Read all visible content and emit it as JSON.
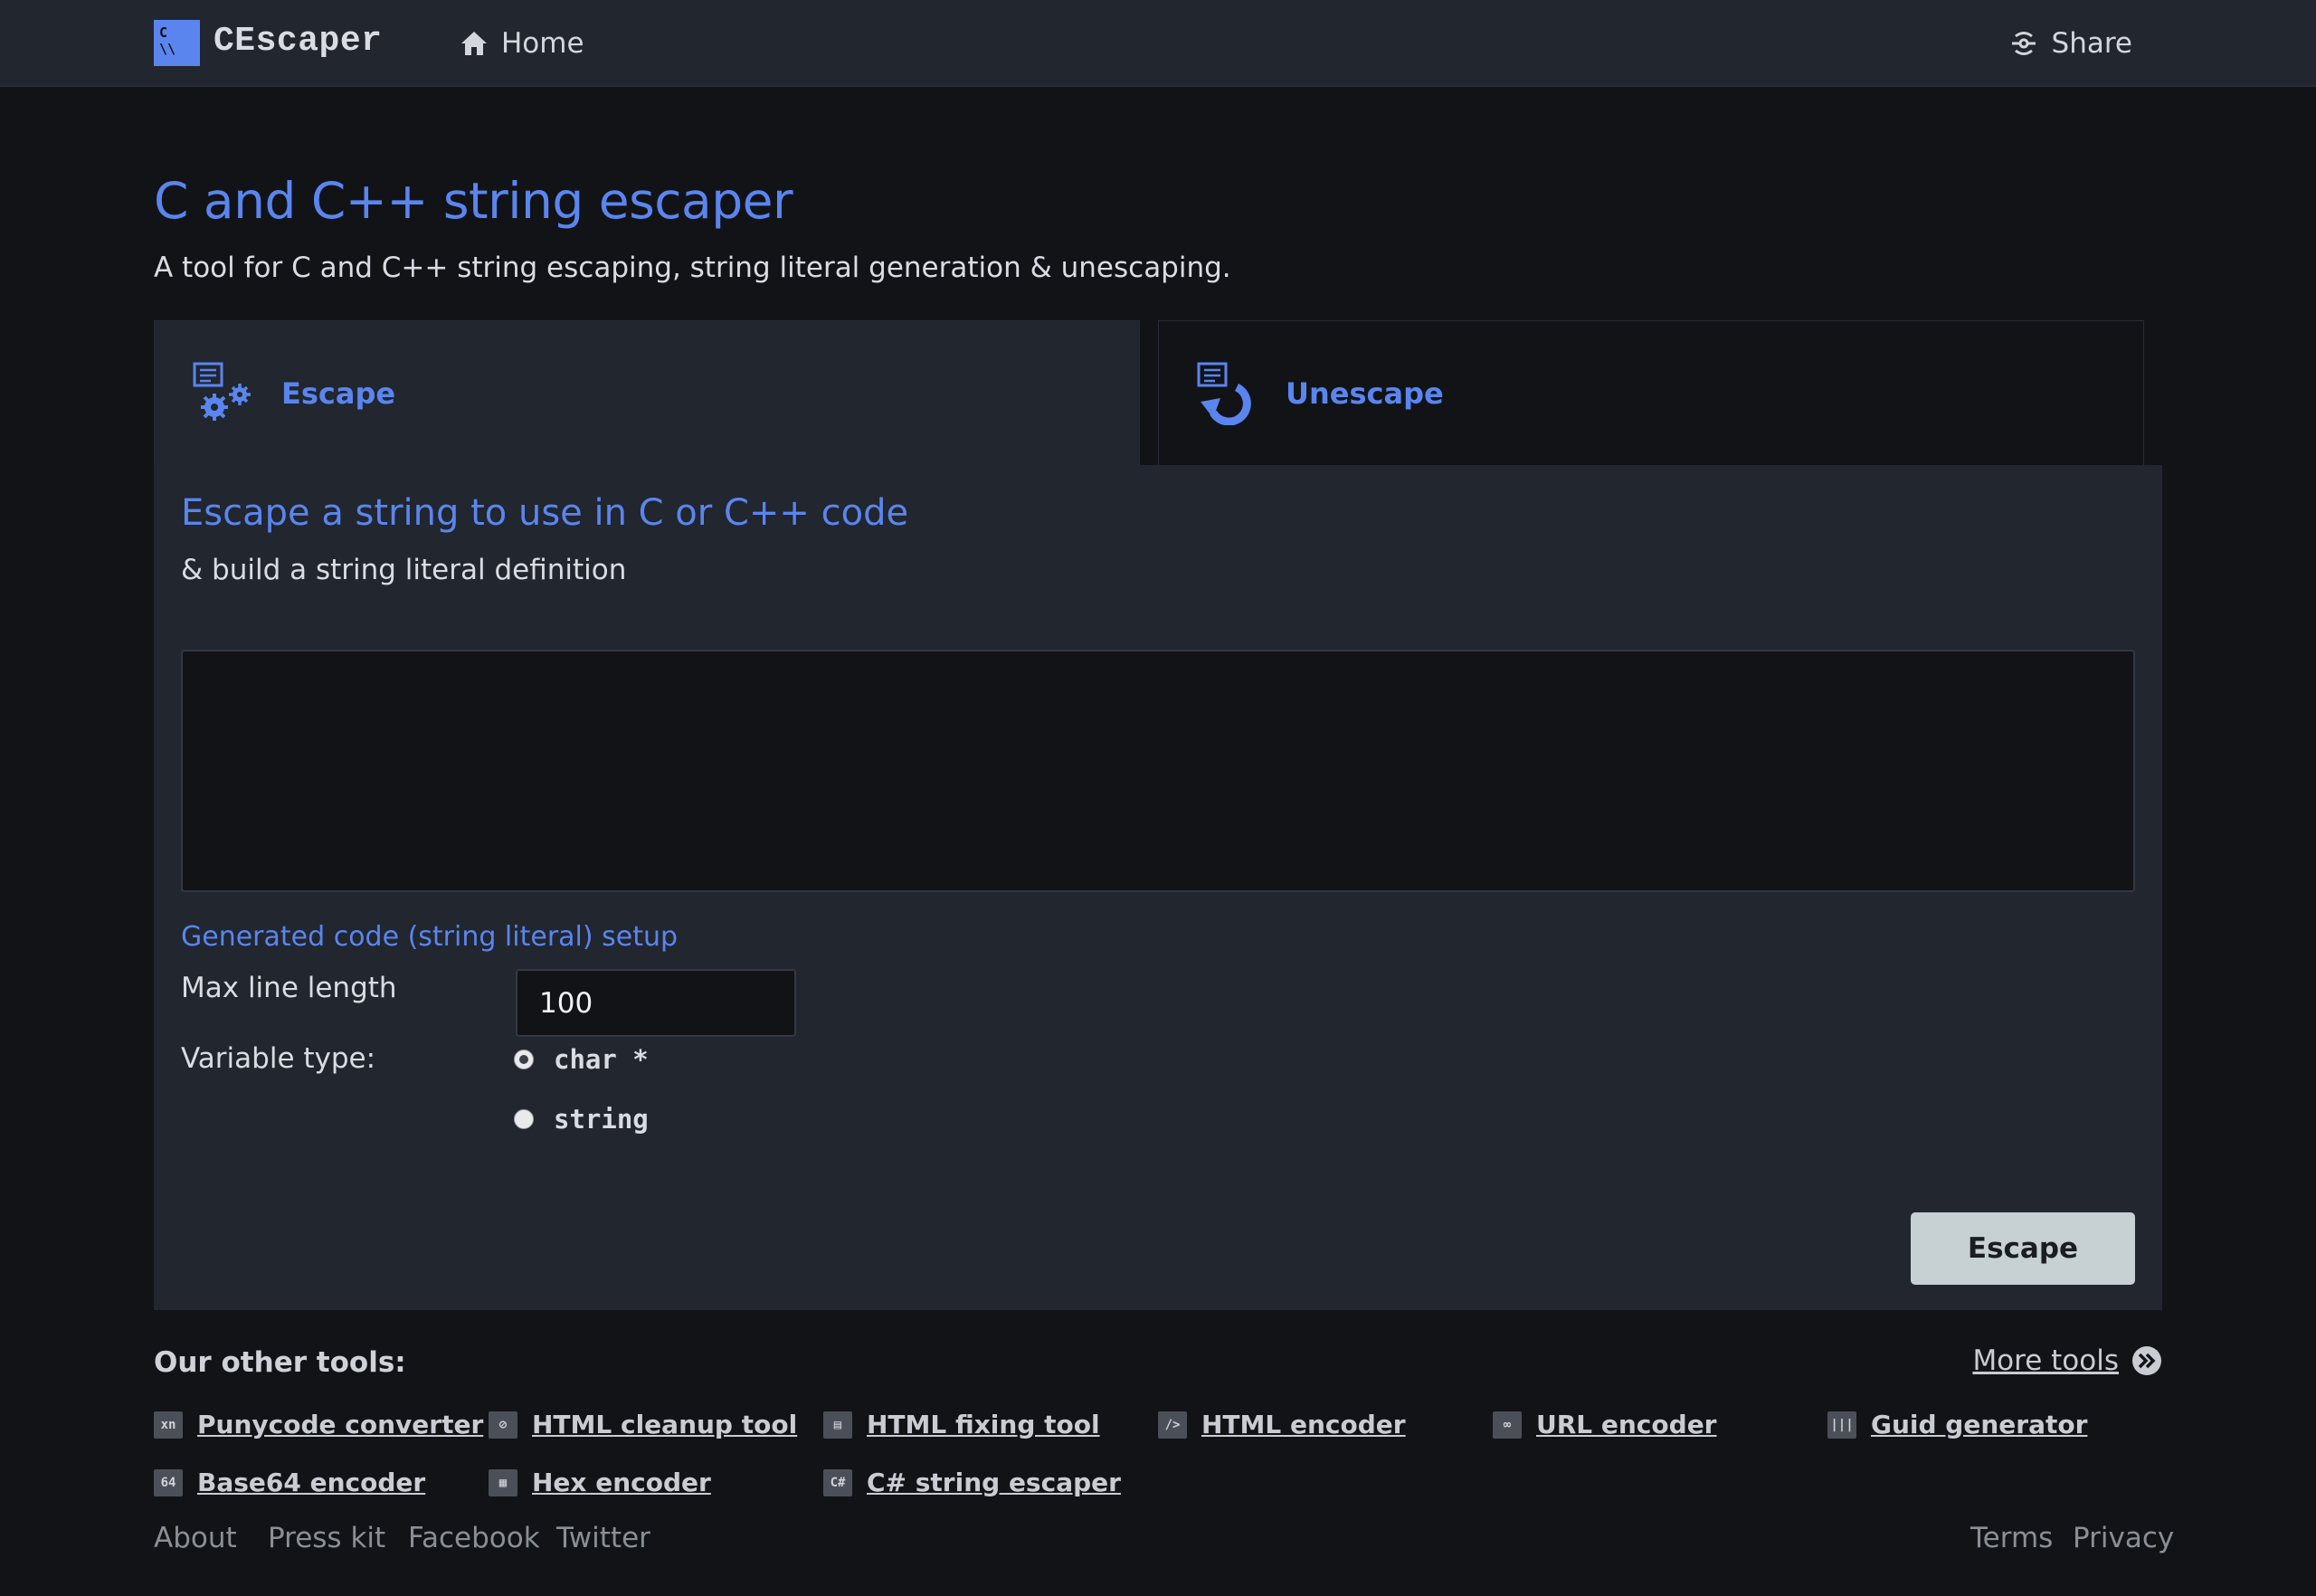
{
  "header": {
    "logo_mark": "C \\\\",
    "logo_line1": "C",
    "logo_line2": "\\\\",
    "brand": "CEscaper",
    "home_label": "Home",
    "share_label": "Share"
  },
  "page": {
    "title": "C and C++ string escaper",
    "subtitle": "A tool for C and C++ string escaping, string literal generation & unescaping."
  },
  "tabs": [
    {
      "label": "Escape",
      "active": true
    },
    {
      "label": "Unescape",
      "active": false
    }
  ],
  "panel": {
    "title": "Escape a string to use in C or C++ code",
    "subtitle": "& build a string literal definition",
    "input_value": "",
    "setup_title": "Generated code (string literal) setup",
    "max_line_label": "Max line length",
    "max_line_value": "100",
    "var_type_label": "Variable type:",
    "var_types": [
      {
        "label": "char *",
        "checked": true
      },
      {
        "label": "string",
        "checked": false
      }
    ],
    "escape_button": "Escape"
  },
  "tools": {
    "title": "Our other tools:",
    "more_label": "More tools",
    "items": [
      {
        "label": "Punycode converter",
        "icon": "xn"
      },
      {
        "label": "HTML cleanup tool",
        "icon": "⊘"
      },
      {
        "label": "HTML fixing tool",
        "icon": "▤"
      },
      {
        "label": "HTML encoder",
        "icon": "/>"
      },
      {
        "label": "URL encoder",
        "icon": "∞"
      },
      {
        "label": "Guid generator",
        "icon": "|||"
      },
      {
        "label": "Base64 encoder",
        "icon": "64"
      },
      {
        "label": "Hex encoder",
        "icon": "▦"
      },
      {
        "label": "C# string escaper",
        "icon": "C#"
      }
    ]
  },
  "footer": {
    "about": "About",
    "press": "Press kit",
    "facebook": "Facebook",
    "twitter": "Twitter",
    "terms": "Terms",
    "privacy": "Privacy"
  },
  "colors": {
    "accent": "#5b85ee",
    "background": "#111317",
    "panel": "#21262f",
    "button": "#c7d1d4"
  }
}
